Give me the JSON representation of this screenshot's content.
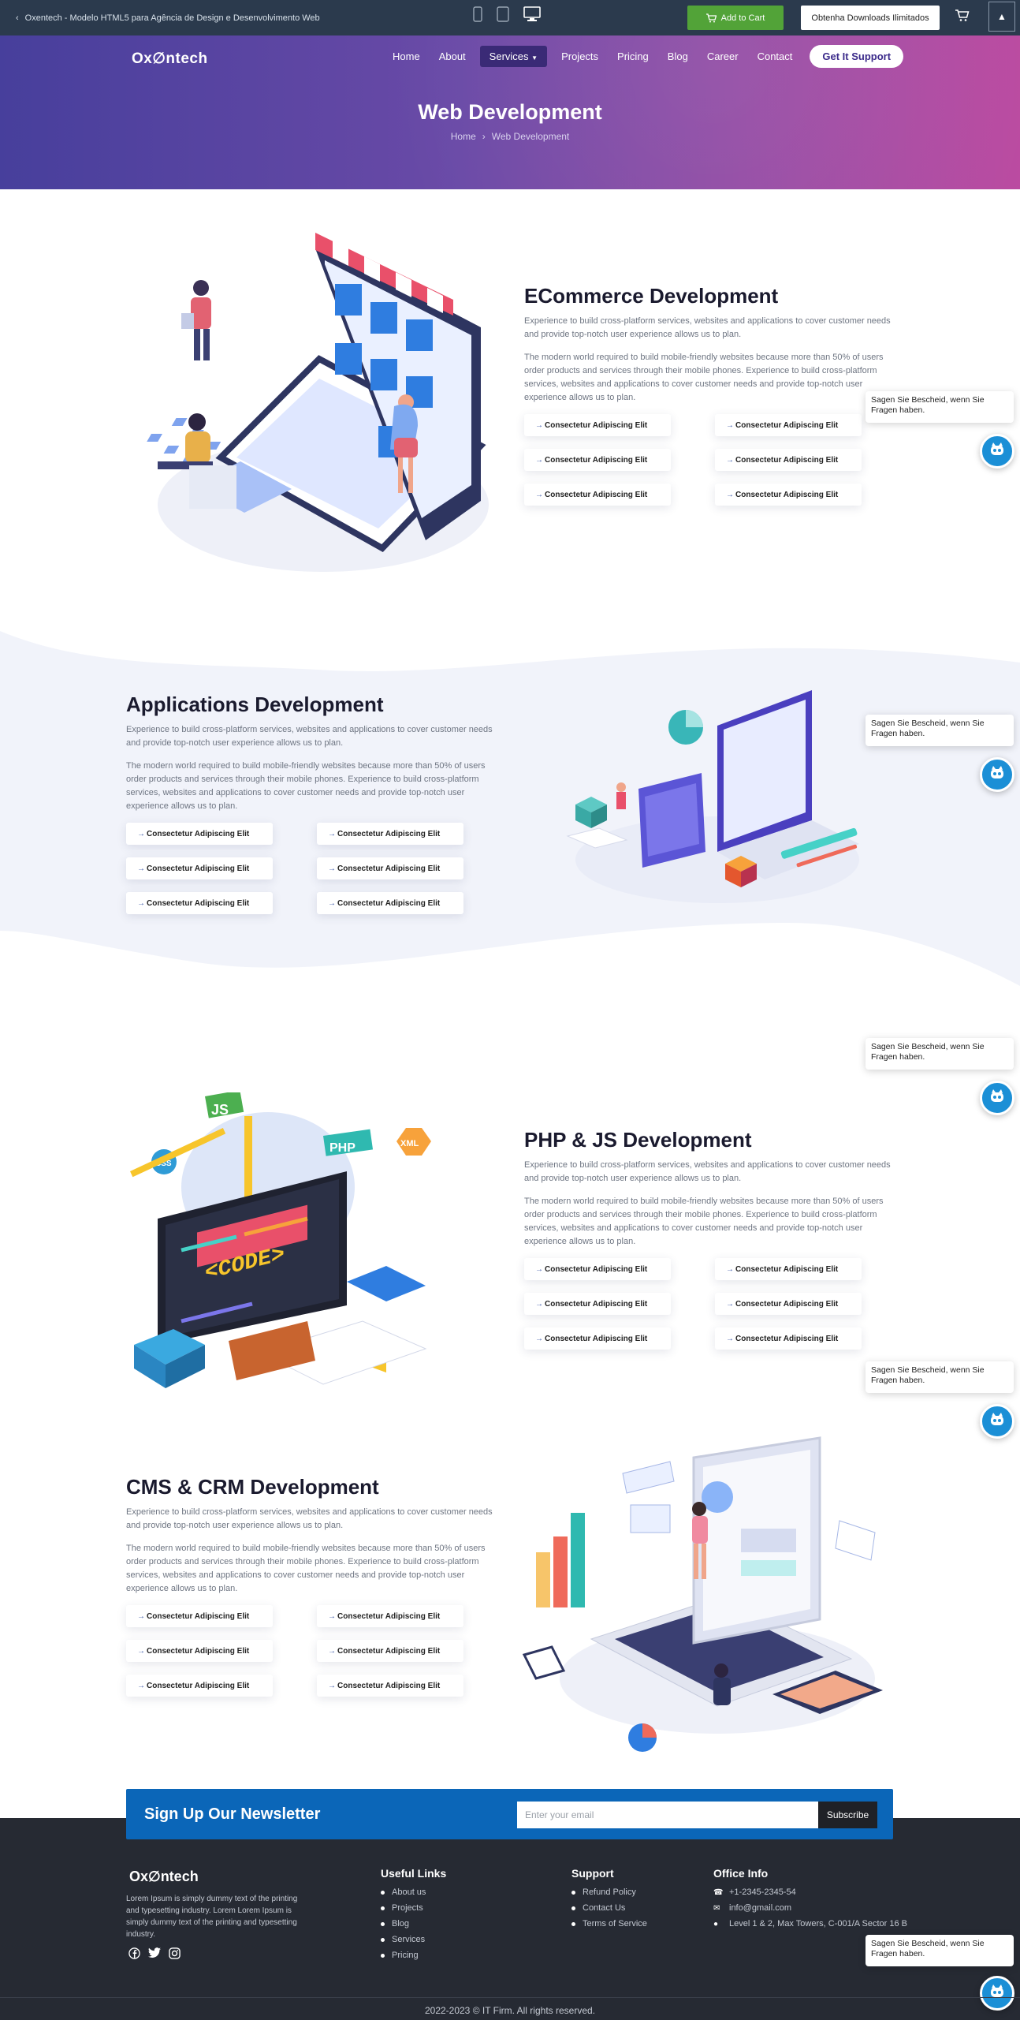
{
  "topbar": {
    "title": "Oxentech - Modelo HTML5 para Agência de Design e Desenvolvimento Web",
    "add_to_cart": "Add to Cart",
    "downloads": "Obtenha Downloads Ilimitados"
  },
  "header": {
    "logo": "Ox∅ntech",
    "nav": [
      "Home",
      "About",
      "Services",
      "Projects",
      "Pricing",
      "Blog",
      "Career",
      "Contact"
    ],
    "cta": "Get It Support",
    "title": "Web Development",
    "breadcrumb": {
      "home": "Home",
      "current": "Web Development"
    }
  },
  "sections": [
    {
      "title": "ECommerce Development",
      "intro": "Experience to build cross-platform services, websites and applications to cover customer needs and provide top-notch user experience allows us to plan.",
      "body": "The modern world required to build mobile-friendly websites because more than 50% of users order products and services through their mobile phones. Experience to build cross-platform services, websites and applications to cover customer needs and provide top-notch user experience allows us to plan.",
      "features": [
        "Consectetur Adipiscing Elit",
        "Consectetur Adipiscing Elit",
        "Consectetur Adipiscing Elit",
        "Consectetur Adipiscing Elit",
        "Consectetur Adipiscing Elit",
        "Consectetur Adipiscing Elit"
      ]
    },
    {
      "title": "Applications Development",
      "intro": "Experience to build cross-platform services, websites and applications to cover customer needs and provide top-notch user experience allows us to plan.",
      "body": "The modern world required to build mobile-friendly websites because more than 50% of users order products and services through their mobile phones. Experience to build cross-platform services, websites and applications to cover customer needs and provide top-notch user experience allows us to plan.",
      "features": [
        "Consectetur Adipiscing Elit",
        "Consectetur Adipiscing Elit",
        "Consectetur Adipiscing Elit",
        "Consectetur Adipiscing Elit",
        "Consectetur Adipiscing Elit",
        "Consectetur Adipiscing Elit"
      ]
    },
    {
      "title": "PHP & JS Development",
      "intro": "Experience to build cross-platform services, websites and applications to cover customer needs and provide top-notch user experience allows us to plan.",
      "body": "The modern world required to build mobile-friendly websites because more than 50% of users order products and services through their mobile phones. Experience to build cross-platform services, websites and applications to cover customer needs and provide top-notch user experience allows us to plan.",
      "features": [
        "Consectetur Adipiscing Elit",
        "Consectetur Adipiscing Elit",
        "Consectetur Adipiscing Elit",
        "Consectetur Adipiscing Elit",
        "Consectetur Adipiscing Elit",
        "Consectetur Adipiscing Elit"
      ],
      "illustration_labels": {
        "js": "JS",
        "php": "PHP",
        "xml": "XML",
        "css": "CSS",
        "code": "<CODE>"
      }
    },
    {
      "title": "CMS & CRM Development",
      "intro": "Experience to build cross-platform services, websites and applications to cover customer needs and provide top-notch user experience allows us to plan.",
      "body": "The modern world required to build mobile-friendly websites because more than 50% of users order products and services through their mobile phones. Experience to build cross-platform services, websites and applications to cover customer needs and provide top-notch user experience allows us to plan.",
      "features": [
        "Consectetur Adipiscing Elit",
        "Consectetur Adipiscing Elit",
        "Consectetur Adipiscing Elit",
        "Consectetur Adipiscing Elit",
        "Consectetur Adipiscing Elit",
        "Consectetur Adipiscing Elit"
      ]
    }
  ],
  "chat": {
    "prompt": "Sagen Sie Bescheid, wenn Sie Fragen haben."
  },
  "newsletter": {
    "title": "Sign Up Our Newsletter",
    "placeholder": "Enter your email",
    "button": "Subscribe"
  },
  "footer": {
    "logo": "Ox∅ntech",
    "about": "Lorem Ipsum is simply dummy text of the printing and typesetting industry. Lorem Lorem Ipsum is simply dummy text of the printing and typesetting industry.",
    "useful_links": {
      "title": "Useful Links",
      "items": [
        "About us",
        "Projects",
        "Blog",
        "Services",
        "Pricing"
      ]
    },
    "support": {
      "title": "Support",
      "items": [
        "Refund Policy",
        "Contact Us",
        "Terms of Service"
      ]
    },
    "office": {
      "title": "Office Info",
      "phone": "+1-2345-2345-54",
      "email": "info@gmail.com",
      "address": "Level 1 & 2, Max Towers, C-001/A Sector 16 B"
    },
    "copyright": "2022-2023 © IT Firm. All rights reserved."
  },
  "colors": {
    "accent": "#0b66b8",
    "hero_start": "#473f9c",
    "hero_end": "#bb4ba1",
    "cart_green": "#52a338",
    "footer_bg": "#262a33"
  }
}
